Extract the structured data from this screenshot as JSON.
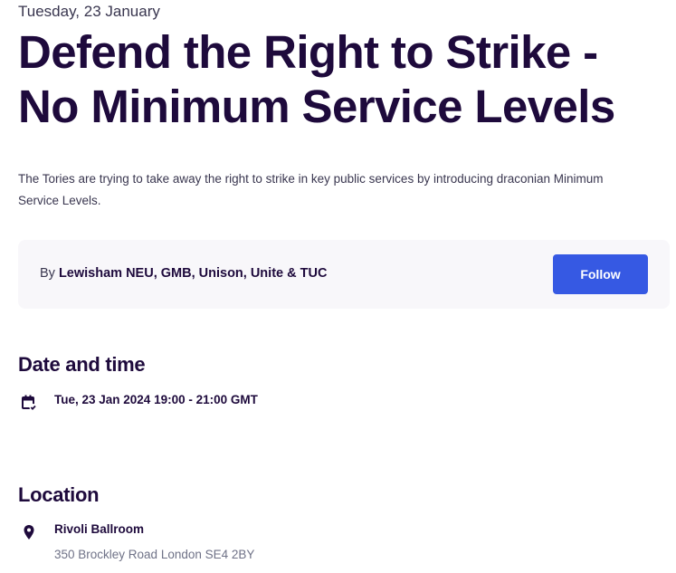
{
  "event": {
    "date_label": "Tuesday, 23 January",
    "title": "Defend the Right to Strike - No Minimum Service Levels",
    "summary": "The Tories are trying to take away the right to strike in key public services by introducing draconian Minimum Service Levels."
  },
  "organizer": {
    "by_prefix": "By ",
    "name": "Lewisham NEU, GMB, Unison, Unite & TUC",
    "follow_label": "Follow"
  },
  "date_time": {
    "heading": "Date and time",
    "icon": "calendar-check-icon",
    "value": "Tue, 23 Jan 2024 19:00 - 21:00 GMT"
  },
  "location": {
    "heading": "Location",
    "icon": "map-pin-icon",
    "venue": "Rivoli Ballroom",
    "address": "350 Brockley Road London SE4 2BY"
  },
  "colors": {
    "text_primary": "#1e0a3c",
    "text_secondary": "#39364f",
    "text_muted": "#6f7287",
    "accent_button": "#3659e3",
    "card_background": "#f8f7fa"
  }
}
